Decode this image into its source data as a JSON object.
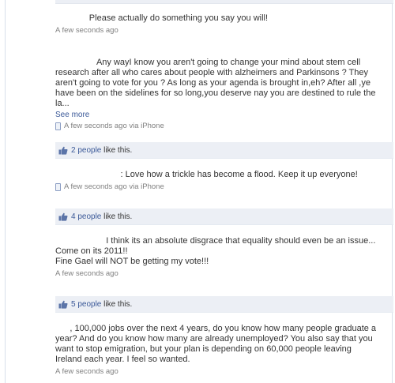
{
  "comments": [
    {
      "text": "              Please actually do something you say you will!",
      "meta": "A few seconds ago"
    },
    {
      "text": "                 Any wayI know you aren't going to change your mind about stem cell research after all who cares about people with alzheimers and Parkinsons ? They aren't going to vote for you ? As long as your agenda is brought in,eh? After all ,ye have been on the sidelines for so long,you deserve nay you are destined to rule the la...",
      "see_more": "See more",
      "meta": "A few seconds ago via iPhone",
      "likes_link": "2 people",
      "likes_suffix": " like this."
    },
    {
      "text": "                           : Love how a trickle has become a flood. Keep it up everyone!",
      "meta": "A few seconds ago via iPhone",
      "likes_link": "4 people",
      "likes_suffix": " like this."
    },
    {
      "text": "                     I think its an absolute disgrace that equality should even be an issue...\nCome on its 2011!!\nFine Gael will NOT be getting my vote!!!",
      "meta": "A few seconds ago",
      "likes_link": "5 people",
      "likes_suffix": " like this."
    },
    {
      "text": "      , 100,000 jobs over the next 4 years, do you know how many people graduate a year? And do you know how many are already unemployed? You also say that you want to stop emigration, but your plan is depending on 60,000 people leaving Ireland each year. I feel so wanted.",
      "meta": "A few seconds ago"
    }
  ]
}
